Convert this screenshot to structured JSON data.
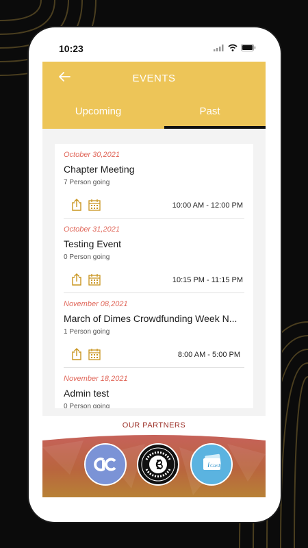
{
  "status": {
    "time": "10:23"
  },
  "header": {
    "title": "EVENTS"
  },
  "tabs": [
    {
      "label": "Upcoming"
    },
    {
      "label": "Past"
    }
  ],
  "events": [
    {
      "date": "October 30,2021",
      "name": "Chapter Meeting",
      "going": "7 Person going",
      "time": "10:00 AM - 12:00 PM"
    },
    {
      "date": "October 31,2021",
      "name": "Testing Event",
      "going": "0 Person going",
      "time": "10:15 PM - 11:15 PM"
    },
    {
      "date": "November 08,2021",
      "name": "March of Dimes Crowdfunding Week N...",
      "going": "1 Person going",
      "time": "8:00 AM - 5:00 PM"
    },
    {
      "date": "November 18,2021",
      "name": "Admin test",
      "going": "0 Person going",
      "time": ""
    }
  ],
  "partners": {
    "title": "OUR PARTNERS",
    "logos": [
      {
        "label": "ac",
        "icon": "ac-logo-icon"
      },
      {
        "label": "GLOBAL LUXURY",
        "icon": "global-luxury-logo-icon"
      },
      {
        "label": "iCard",
        "icon": "icard-logo-icon"
      }
    ]
  },
  "colors": {
    "header": "#edc558",
    "accent": "#c9951f",
    "date": "#e0675a",
    "partners_title": "#9a2b22"
  }
}
